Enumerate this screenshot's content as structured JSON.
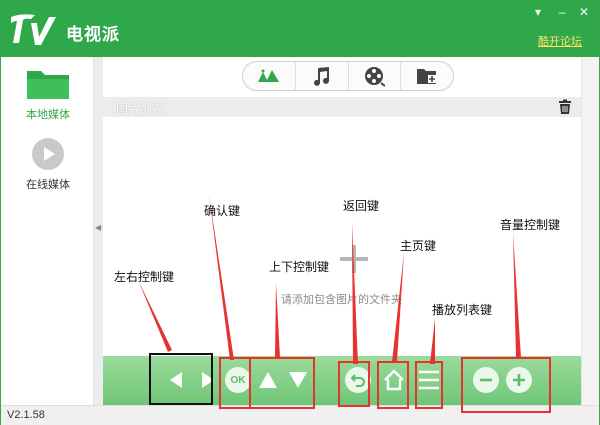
{
  "app": {
    "title": "电视派",
    "forum_link": "酷开论坛",
    "version": "V2.1.58"
  },
  "sidebar": {
    "items": [
      {
        "label": "本地媒体",
        "icon": "folder-icon",
        "active": true
      },
      {
        "label": "在线媒体",
        "icon": "play-circle-icon",
        "active": false
      }
    ]
  },
  "media_tabs": [
    {
      "icon": "image-icon",
      "selected": true
    },
    {
      "icon": "music-icon",
      "selected": false
    },
    {
      "icon": "film-reel-icon",
      "selected": false
    },
    {
      "icon": "folder-add-icon",
      "selected": false
    }
  ],
  "list": {
    "title": "图片列表",
    "hint": "请添加包含图片的文件夹"
  },
  "controls": [
    {
      "name": "left-button",
      "icon": "left-arrow-icon"
    },
    {
      "name": "right-button",
      "icon": "right-arrow-icon"
    },
    {
      "name": "ok-button",
      "label": "OK"
    },
    {
      "name": "up-button",
      "icon": "up-arrow-icon"
    },
    {
      "name": "down-button",
      "icon": "down-arrow-icon"
    },
    {
      "name": "back-button",
      "icon": "back-icon"
    },
    {
      "name": "home-button",
      "icon": "home-icon"
    },
    {
      "name": "playlist-button",
      "icon": "list-icon"
    },
    {
      "name": "volume-down-button",
      "icon": "minus-icon"
    },
    {
      "name": "volume-up-button",
      "icon": "plus-icon"
    }
  ],
  "annotations": {
    "left_right": "左右控制键",
    "confirm": "确认键",
    "up_down": "上下控制键",
    "back": "返回键",
    "home": "主页键",
    "playlist": "播放列表键",
    "volume": "音量控制键"
  },
  "colors": {
    "brand": "#2fa84a",
    "forum_link": "#ffe26a",
    "annotation": "#e8322f",
    "control_bar": "#7fcd85"
  }
}
